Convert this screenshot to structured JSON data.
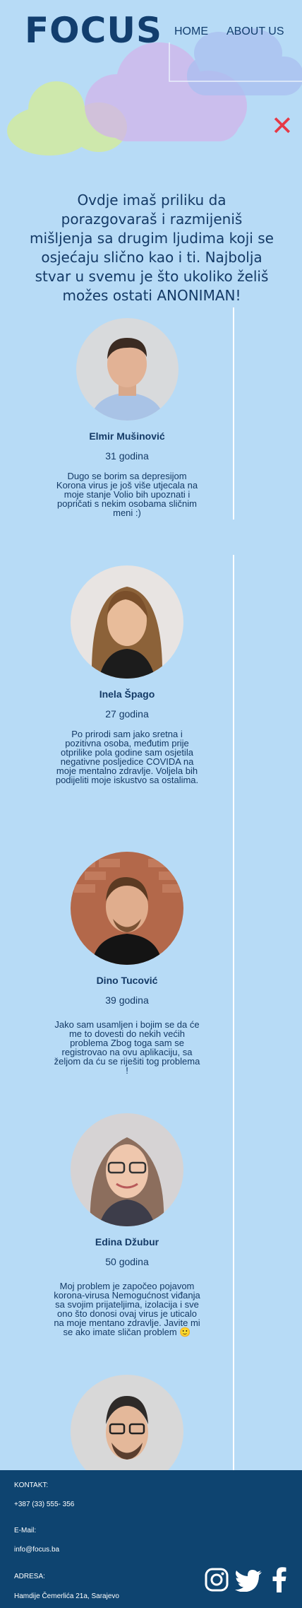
{
  "header": {
    "logo": "FOCUS",
    "nav": [
      {
        "label": "HOME"
      },
      {
        "label": "ABOUT US"
      }
    ],
    "close_symbol": "✕"
  },
  "intro": "Ovdje imaš priliku da porazgovaraš i razmijeniš mišljenja sa drugim ljudima koji se osjećaju slično kao i ti. Najbolja stvar u svemu je što ukoliko želiš možes ostati ANONIMAN!",
  "people": [
    {
      "name": "Elmir Mušinović",
      "age": "31 godina",
      "text": "Dugo se borim sa depresijom Korona virus je još više utjecala na moje stanje Volio bih upoznati i popričati s nekim osobama sličnim meni :)"
    },
    {
      "name": "Inela Špago",
      "age": "27 godina",
      "text": "Po prirodi sam jako sretna i pozitivna osoba, međutim prije otprilike pola godine sam osjetila negativne posljedice COVIDA na moje mentalno zdravlje. Voljela bih podijeliti moje iskustvo sa ostalima."
    },
    {
      "name": "Dino Tucović",
      "age": "39 godina",
      "text": "Jako sam usamljen i bojim se da će me to dovesti do nekih većih problema Zbog toga sam se registrovao na ovu aplikaciju, sa željom da ću se riješiti tog problema !"
    },
    {
      "name": "Edina Džubur",
      "age": "50 godina",
      "text": "Moj problem je započeo pojavom korona-virusa Nemogućnost viđanja sa svojim prijateljima, izolacija i sve ono što donosi ovaj virus je uticalo na moje mentano zdravlje. Javite mi se ako imate sličan problem 🙂"
    }
  ],
  "footer": {
    "contact_label": "KONTAKT:",
    "phone": "+387 (33) 555- 356",
    "email_label": "E-Mail:",
    "email": "info@focus.ba",
    "address_label": "ADRESA:",
    "address": "Hamdije Čemerlića 21a, Sarajevo",
    "icons": [
      "instagram-icon",
      "twitter-icon",
      "facebook-icon"
    ]
  },
  "colors": {
    "background": "#b7dbf6",
    "footer": "#0e4470",
    "accent": "#e63946",
    "text": "#143a66"
  }
}
